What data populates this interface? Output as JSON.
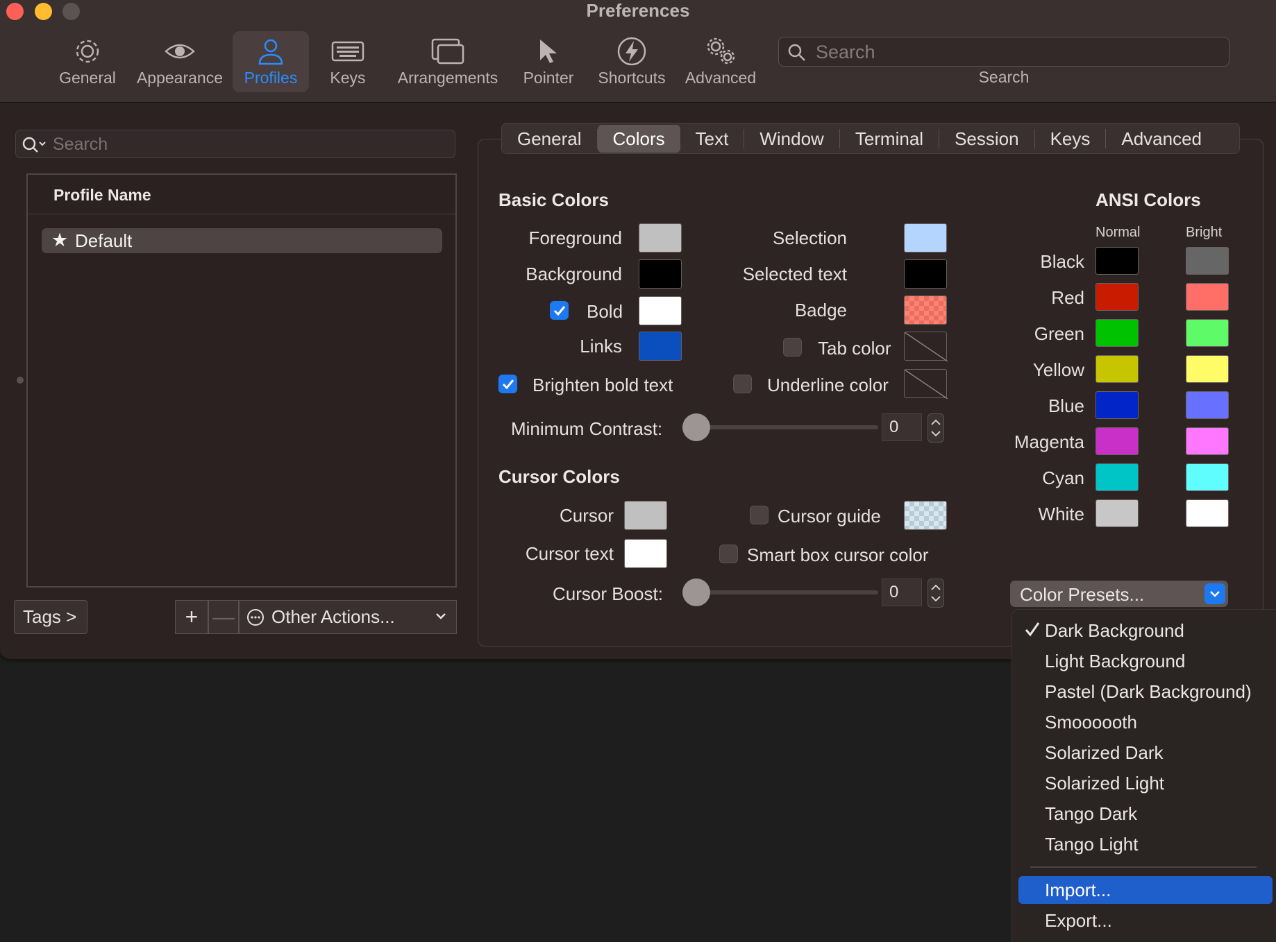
{
  "window": {
    "title": "Preferences"
  },
  "toolbar": {
    "items": [
      {
        "label": "General",
        "icon": "gear-icon"
      },
      {
        "label": "Appearance",
        "icon": "eye-icon"
      },
      {
        "label": "Profiles",
        "icon": "person-icon",
        "active": true
      },
      {
        "label": "Keys",
        "icon": "keyboard-icon"
      },
      {
        "label": "Arrangements",
        "icon": "windows-icon"
      },
      {
        "label": "Pointer",
        "icon": "pointer-icon"
      },
      {
        "label": "Shortcuts",
        "icon": "lightning-icon"
      },
      {
        "label": "Advanced",
        "icon": "gears-icon"
      }
    ],
    "search_placeholder": "Search",
    "search_label": "Search"
  },
  "profiles": {
    "search_placeholder": "Search",
    "column_header": "Profile Name",
    "rows": [
      {
        "name": "Default",
        "default": true
      }
    ],
    "tags_button": "Tags >",
    "add_button": "+",
    "remove_button": "—",
    "other_actions": "Other Actions..."
  },
  "tabs": [
    "General",
    "Colors",
    "Text",
    "Window",
    "Terminal",
    "Session",
    "Keys",
    "Advanced"
  ],
  "active_tab": "Colors",
  "basic_colors": {
    "title": "Basic Colors",
    "foreground": {
      "label": "Foreground",
      "color": "#c0c0c0"
    },
    "background": {
      "label": "Background",
      "color": "#000000"
    },
    "bold": {
      "label": "Bold",
      "color": "#ffffff",
      "checked": true
    },
    "links": {
      "label": "Links",
      "color": "#0b4fbf"
    },
    "selection": {
      "label": "Selection",
      "color": "#b4d5fe"
    },
    "selected_text": {
      "label": "Selected text",
      "color": "#000000"
    },
    "badge": {
      "label": "Badge",
      "color": "#f26b5a"
    },
    "tab_color": {
      "label": "Tab color",
      "checked": false
    },
    "brighten_bold": {
      "label": "Brighten bold text",
      "checked": true
    },
    "underline_color": {
      "label": "Underline color",
      "checked": false
    },
    "min_contrast": {
      "label": "Minimum Contrast:",
      "value": "0"
    }
  },
  "cursor_colors": {
    "title": "Cursor Colors",
    "cursor": {
      "label": "Cursor",
      "color": "#c0c0c0"
    },
    "cursor_text": {
      "label": "Cursor text",
      "color": "#ffffff"
    },
    "cursor_guide": {
      "label": "Cursor guide",
      "checked": false
    },
    "smart_box": {
      "label": "Smart box cursor color",
      "checked": false
    },
    "cursor_boost": {
      "label": "Cursor Boost:",
      "value": "0"
    }
  },
  "ansi": {
    "title": "ANSI Colors",
    "normal_label": "Normal",
    "bright_label": "Bright",
    "rows": [
      {
        "name": "Black",
        "normal": "#000000",
        "bright": "#666666"
      },
      {
        "name": "Red",
        "normal": "#c91b00",
        "bright": "#ff6e67"
      },
      {
        "name": "Green",
        "normal": "#00c200",
        "bright": "#5ffa68"
      },
      {
        "name": "Yellow",
        "normal": "#c7c400",
        "bright": "#fffc67"
      },
      {
        "name": "Blue",
        "normal": "#0225c7",
        "bright": "#6871ff"
      },
      {
        "name": "Magenta",
        "normal": "#c930c7",
        "bright": "#ff77ff"
      },
      {
        "name": "Cyan",
        "normal": "#00c5c7",
        "bright": "#60fdff"
      },
      {
        "name": "White",
        "normal": "#c7c7c7",
        "bright": "#ffffff"
      }
    ]
  },
  "presets": {
    "button": "Color Presets...",
    "items": [
      {
        "label": "Dark Background",
        "checked": true
      },
      {
        "label": "Light Background"
      },
      {
        "label": "Pastel (Dark Background)"
      },
      {
        "label": "Smoooooth"
      },
      {
        "label": "Solarized Dark"
      },
      {
        "label": "Solarized Light"
      },
      {
        "label": "Tango Dark"
      },
      {
        "label": "Tango Light"
      }
    ],
    "import": "Import...",
    "export": "Export..."
  },
  "colors": {
    "accent": "#1e78f0",
    "active_tool": "#2a8dff"
  }
}
